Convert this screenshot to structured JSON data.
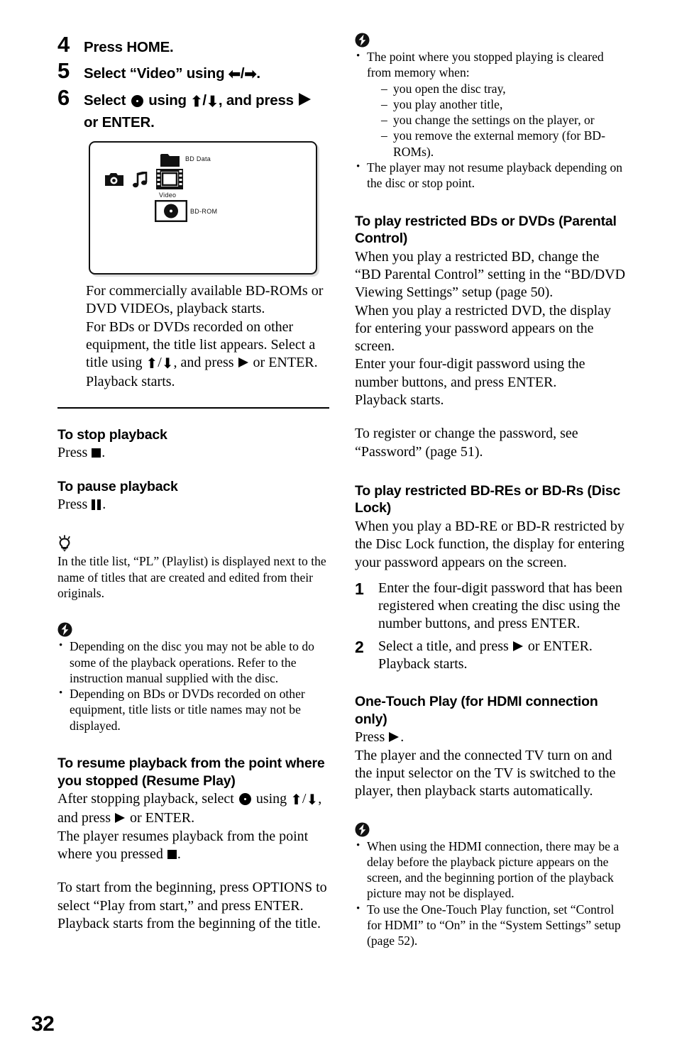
{
  "page": {
    "number": "32"
  },
  "left_column": {
    "steps": [
      {
        "num": "4",
        "text_before": "Press HOME.",
        "kind": "plain"
      },
      {
        "num": "5",
        "text_before": "Select “Video” using ",
        "text_after": ".",
        "kind": "leftright"
      },
      {
        "num": "6",
        "text_before": "Select ",
        "text_mid": " using ",
        "text_mid2": ", and press ",
        "text_after": " or ENTER.",
        "kind": "select"
      }
    ],
    "screen": {
      "caption_bd_data": "BD Data",
      "caption_video": "Video",
      "caption_bd_rom": "BD-ROM",
      "icons": [
        "camera-icon",
        "music-note-icon",
        "film-strip-icon",
        "folder-icon",
        "disc-icon"
      ]
    },
    "intro_paragraph_1": "For commercially available BD-ROMs or DVD VIDEOs, playback starts.",
    "intro_paragraph_2a": "For BDs or DVDs recorded on other equipment, the title list appears. Select a title using ",
    "intro_paragraph_2b": ", and press ",
    "intro_paragraph_2c": " or ENTER.",
    "intro_paragraph_3": "Playback starts.",
    "stop": {
      "heading": "To stop playback",
      "press_prefix": "Press ",
      "press_suffix": "."
    },
    "pause": {
      "heading": "To pause playback",
      "press_prefix": "Press ",
      "press_suffix": "."
    },
    "tip": {
      "icon": "tip-lightbulb-icon",
      "body": "In the title list, “PL” (Playlist) is displayed next to the name of titles that are created and edited from their originals."
    },
    "note": {
      "icon": "note-lightning-icon",
      "bullets": [
        "Depending on the disc you may not be able to do some of the playback operations. Refer to the instruction manual supplied with the disc.",
        "Depending on BDs or DVDs recorded on other equipment, title lists or title names may not be displayed."
      ]
    },
    "resume": {
      "heading": "To resume playback from the point where you stopped (Resume Play)",
      "para1a": "After stopping playback, select ",
      "para1b": " using ",
      "para1c": ", and press ",
      "para1d": " or ENTER.",
      "para2a": "The player resumes playback from the point where you pressed ",
      "para2b": ".",
      "para3": "To start from the beginning, press OPTIONS to select “Play from start,” and press ENTER. Playback starts from the beginning of the title."
    }
  },
  "right_column": {
    "note_top": {
      "icon": "note-lightning-icon",
      "bullet1_lead": "The point where you stopped playing is cleared from memory when:",
      "bullet1_dashes": [
        "you open the disc tray,",
        "you play another title,",
        "you change the settings on the player, or",
        "you remove the external memory (for BD-ROMs)."
      ],
      "bullet2": "The player may not resume playback depending on the disc or stop point."
    },
    "parental": {
      "heading": "To play restricted BDs or DVDs (Parental Control)",
      "para1": "When you play a restricted BD, change the “BD Parental Control” setting in the “BD/DVD Viewing Settings” setup (page 50).",
      "para2": "When you play a restricted DVD, the display for entering your password appears on the screen.",
      "para3": "Enter your four-digit password using the number buttons, and press ENTER.",
      "para4": "Playback starts.",
      "para5": "To register or change the password, see “Password” (page 51)."
    },
    "disc_lock": {
      "heading": "To play restricted BD-REs or BD-Rs (Disc Lock)",
      "para1": "When you play a BD-RE or BD-R restricted by the Disc Lock function, the display for entering your password appears on the screen.",
      "steps": [
        {
          "num": "1",
          "text": "Enter the four-digit password that has been registered when creating the disc using the number buttons, and press ENTER."
        },
        {
          "num": "2",
          "text_a": "Select a title, and press ",
          "text_b": " or ENTER.",
          "text_c": "Playback starts."
        }
      ]
    },
    "one_touch": {
      "heading": "One-Touch Play (for HDMI connection only)",
      "press_prefix": "Press ",
      "press_suffix": ".",
      "para1": "The player and the connected TV turn on and the input selector on the TV is switched to the player, then playback starts automatically."
    },
    "note_bottom": {
      "icon": "note-lightning-icon",
      "bullets": [
        "When using the HDMI connection, there may be a delay before the playback picture appears on the screen, and the beginning portion of the playback picture may not be displayed.",
        "To use the One-Touch Play function, set “Control for HDMI” to “On” in the “System Settings” setup (page 52)."
      ]
    }
  }
}
